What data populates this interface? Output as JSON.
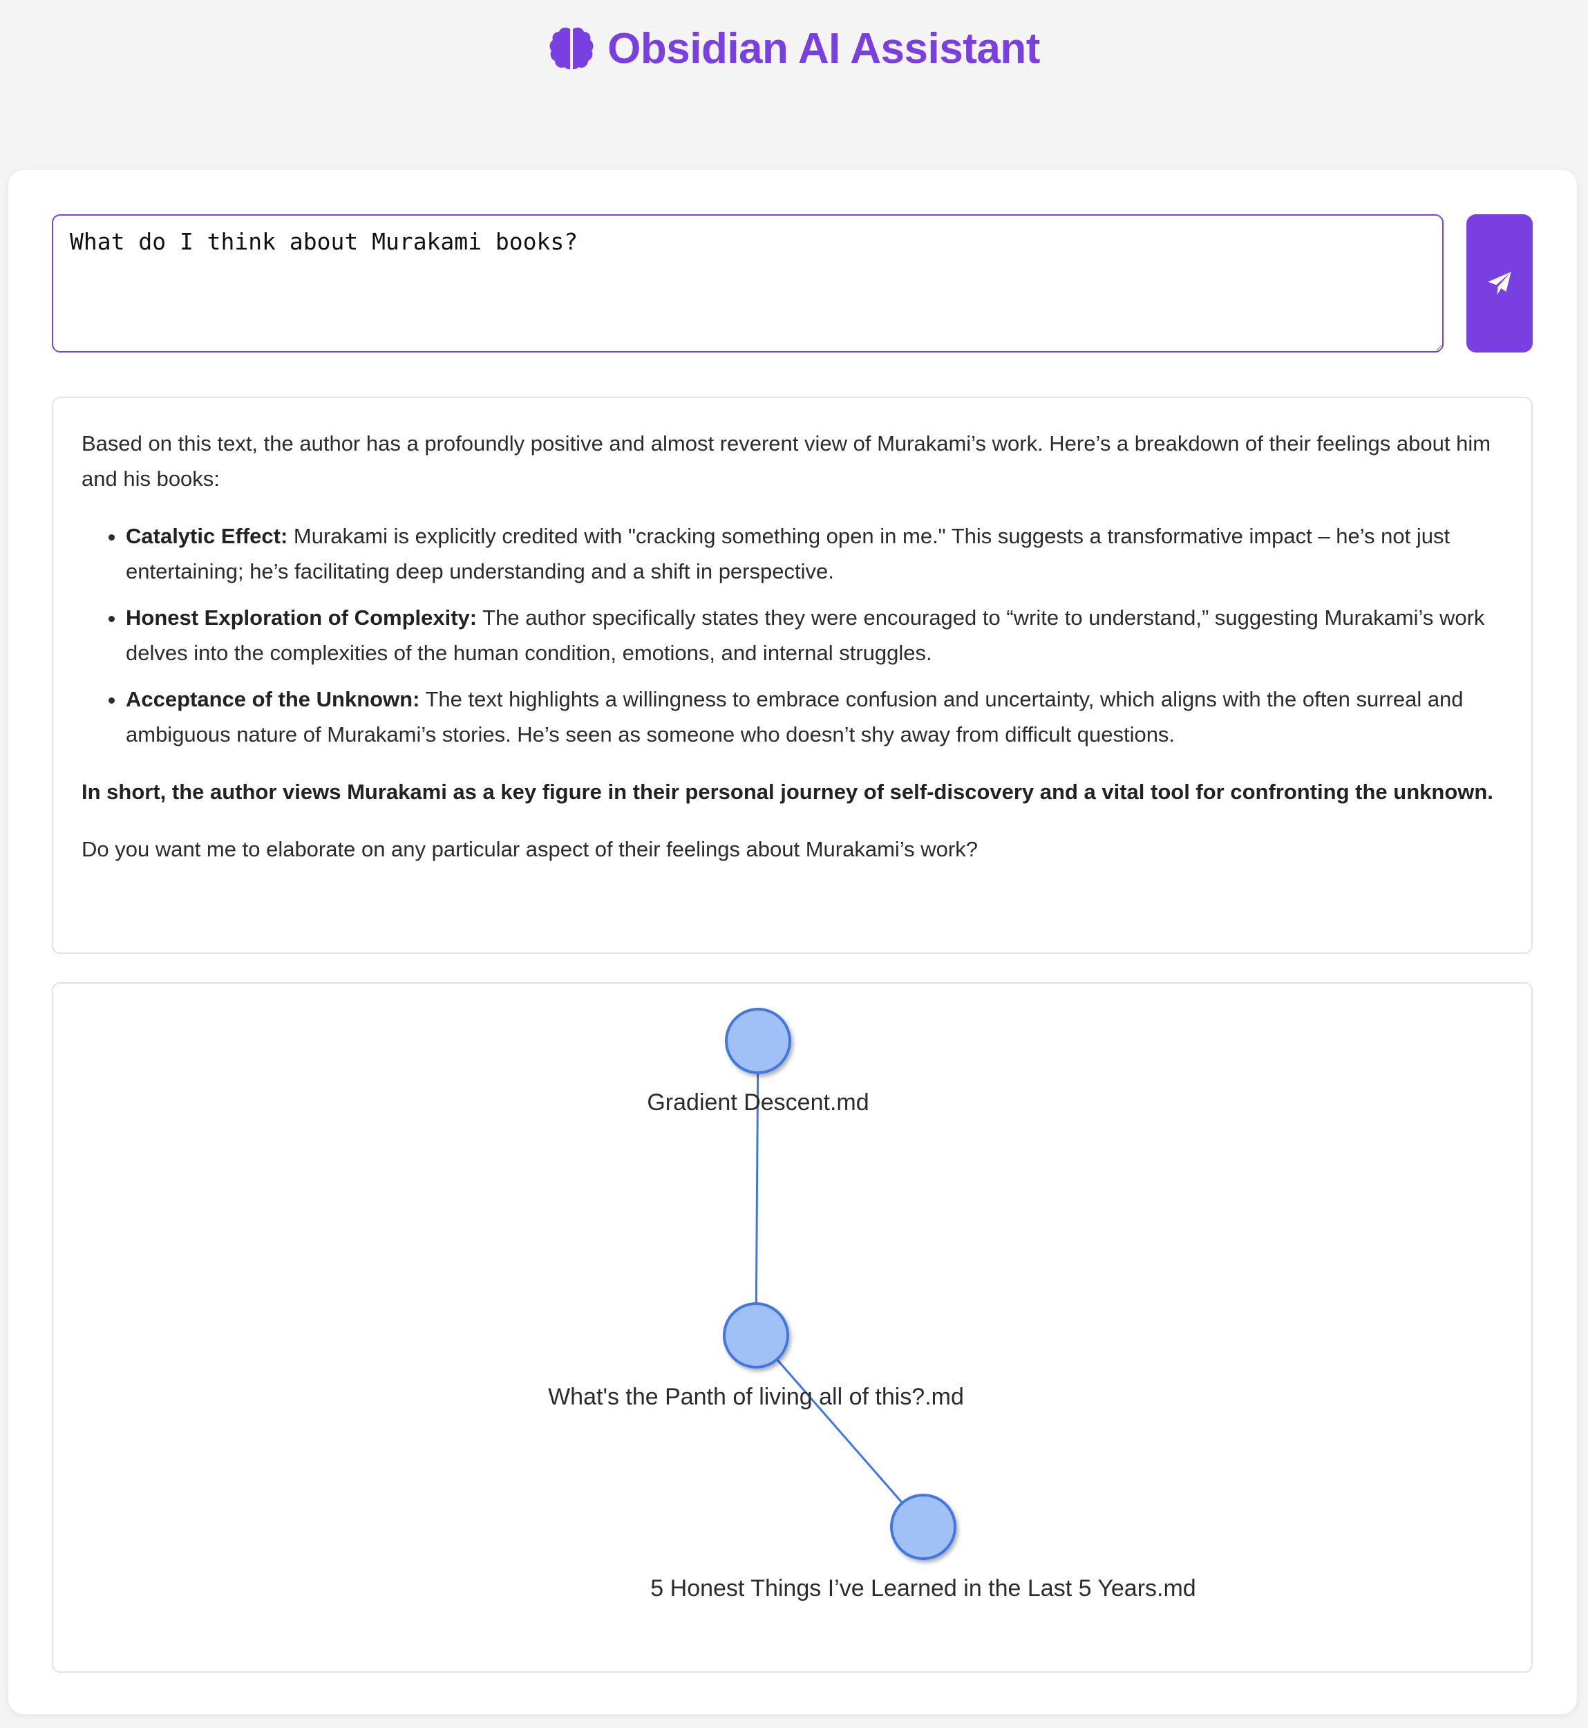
{
  "app": {
    "title": "Obsidian AI Assistant",
    "icon": "brain-icon",
    "accent_color": "#7a3fe0"
  },
  "query": {
    "value": "What do I think about Murakami books?",
    "send_icon": "paper-plane-icon"
  },
  "answer": {
    "intro": "Based on this text, the author has a profoundly positive and almost reverent view of Murakami’s work. Here’s a breakdown of their feelings about him and his books:",
    "points": [
      {
        "title": "Catalytic Effect:",
        "text": " Murakami is explicitly credited with \"cracking something open in me.\" This suggests a transformative impact – he’s not just entertaining; he’s facilitating deep understanding and a shift in perspective."
      },
      {
        "title": "Honest Exploration of Complexity:",
        "text": " The author specifically states they were encouraged to “write to understand,” suggesting Murakami’s work delves into the complexities of the human condition, emotions, and internal struggles."
      },
      {
        "title": "Acceptance of the Unknown:",
        "text": " The text highlights a willingness to embrace confusion and uncertainty, which aligns with the often surreal and ambiguous nature of Murakami’s stories. He’s seen as someone who doesn’t shy away from difficult questions."
      }
    ],
    "summary": "In short, the author views Murakami as a key figure in their personal journey of self-discovery and a vital tool for confronting the unknown.",
    "followup": "Do you want me to elaborate on any particular aspect of their feelings about Murakami’s work?"
  },
  "graph": {
    "node_fill": "#a1c0f5",
    "node_stroke": "#3f77e0",
    "edge_color": "#3f77e0",
    "nodes": [
      {
        "id": "n1",
        "label": "Gradient Descent.md"
      },
      {
        "id": "n2",
        "label": "What's the Panth of living all of this?.md"
      },
      {
        "id": "n3",
        "label": "5 Honest Things I’ve Learned in the Last 5 Years.md"
      }
    ],
    "edges": [
      {
        "source": "n1",
        "target": "n2"
      },
      {
        "source": "n2",
        "target": "n3"
      }
    ]
  }
}
